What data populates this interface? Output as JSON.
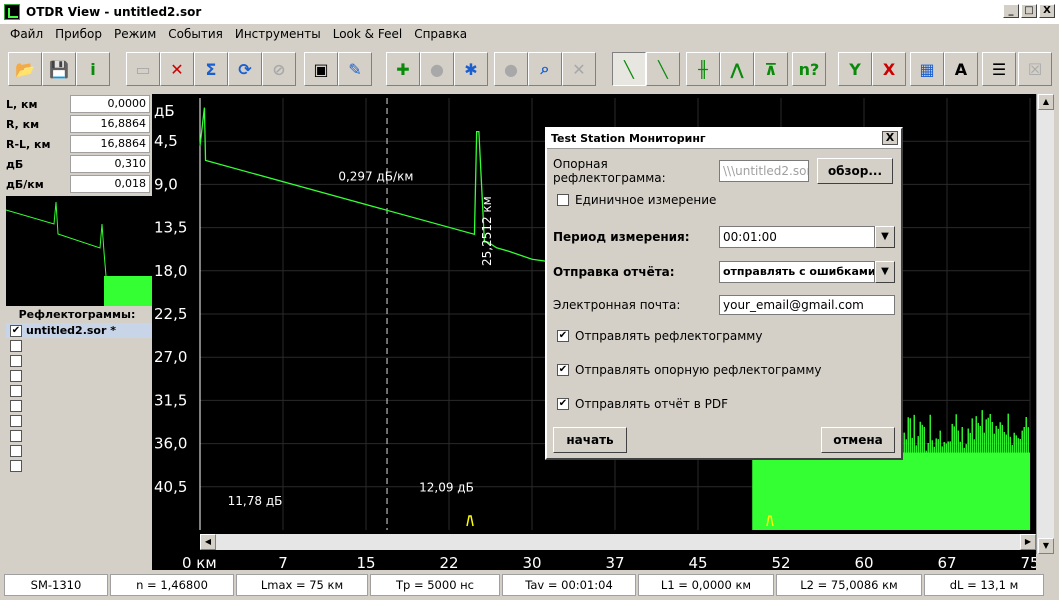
{
  "window": {
    "title": "OTDR View - untitled2.sor",
    "min": "_",
    "max": "□",
    "close": "X"
  },
  "menu": [
    "Файл",
    "Прибор",
    "Режим",
    "События",
    "Инструменты",
    "Look & Feel",
    "Справка"
  ],
  "toolbar_icons": [
    "open-folder-icon",
    "save-icon",
    "info-icon",
    "device-icon",
    "cancel-measure-icon",
    "sum-refresh-icon",
    "refresh-icon",
    "stop-icon",
    "screen-icon",
    "tools-icon",
    "add-event-icon",
    "remove-event-icon",
    "edit-event-icon",
    "delete-event-icon",
    "search-event-icon",
    "clear-events-icon",
    "trace-mode-icon",
    "trace-mode-2-icon",
    "trace-mode-3-icon",
    "trace-mode-4-icon",
    "trace-mode-5-icon",
    "help-n-icon",
    "marker-green-icon",
    "marker-red-icon",
    "table-icon",
    "text-marker-icon",
    "report-icon",
    "close-doc-icon"
  ],
  "toolbar_help_label": "n?",
  "measurements": [
    {
      "label": "L, км",
      "value": "0,0000"
    },
    {
      "label": "R, км",
      "value": "16,8864"
    },
    {
      "label": "R-L, км",
      "value": "16,8864"
    },
    {
      "label": "дБ",
      "value": "0,310"
    },
    {
      "label": "дБ/км",
      "value": "0,018"
    }
  ],
  "reflectograms": {
    "title": "Рефлектограммы:",
    "items": [
      {
        "name": "untitled2.sor *",
        "checked": "✔"
      }
    ]
  },
  "chart_data": {
    "type": "line",
    "ylabel": "дБ",
    "x_ticks": [
      "0 км",
      "7",
      "15",
      "22",
      "30",
      "37",
      "45",
      "52",
      "60",
      "67",
      "75"
    ],
    "y_ticks": [
      "4,5",
      "9,0",
      "13,5",
      "18,0",
      "22,5",
      "27,0",
      "31,5",
      "36,0",
      "40,5"
    ],
    "xlim": [
      0,
      75
    ],
    "ylim": [
      0,
      45
    ],
    "y_inverted": true,
    "grid": true,
    "series": [
      {
        "color": "#33ff33",
        "x": [
          0,
          0.4,
          0.5,
          24.8,
          25.0,
          25.2,
          25.7,
          26.0,
          26.8,
          28,
          30,
          35,
          40,
          45,
          49.5,
          49.9,
          50.0,
          75
        ],
        "y": [
          5.0,
          1.0,
          6.5,
          14.2,
          3.5,
          3.5,
          15.0,
          15.0,
          15.6,
          16.0,
          16.8,
          17.6,
          18.3,
          18.9,
          19.3,
          19.3,
          37.0,
          37.0
        ]
      }
    ],
    "annotations": [
      {
        "text": "0,297 дБ/км",
        "x": 12.5,
        "y": 8.6
      },
      {
        "text": "25,2512 км",
        "x": 26.3,
        "y": 17.5,
        "rotate": true
      },
      {
        "text": "11,78 дБ",
        "x": 2.5,
        "y": 42.4
      },
      {
        "text": "12,09 дБ",
        "x": 19.8,
        "y": 41.0
      }
    ],
    "cursor_x": 16.9,
    "noise_start": 49.9,
    "noise_floor": 37.0
  },
  "dialog": {
    "title": "Test Station Мониторинг",
    "close": "X",
    "ref_label": "Опорная рефлектограмма:",
    "ref_value": "\\\\\\untitled2.sor",
    "browse": "обзор...",
    "single_label": "Единичное измерение",
    "period_label": "Период измерения:",
    "period_value": "00:01:00",
    "report_label": "Отправка отчёта:",
    "report_value": "отправлять с ошибками",
    "email_label": "Электронная почта:",
    "email_value": "your_email@gmail.com",
    "send_refl": "Отправлять рефлектограмму",
    "send_ref_refl": "Отправлять опорную рефлектограмму",
    "send_pdf": "Отправлять отчёт в PDF",
    "check_mark": "✔",
    "start": "начать",
    "cancel": "отмена"
  },
  "status": [
    "SM-1310",
    "n = 1,46800",
    "Lmax = 75 км",
    "Tp = 5000 нс",
    "Tav = 00:01:04",
    "L1 = 0,0000 км",
    "L2 = 75,0086 км",
    "dL = 13,1 м"
  ]
}
